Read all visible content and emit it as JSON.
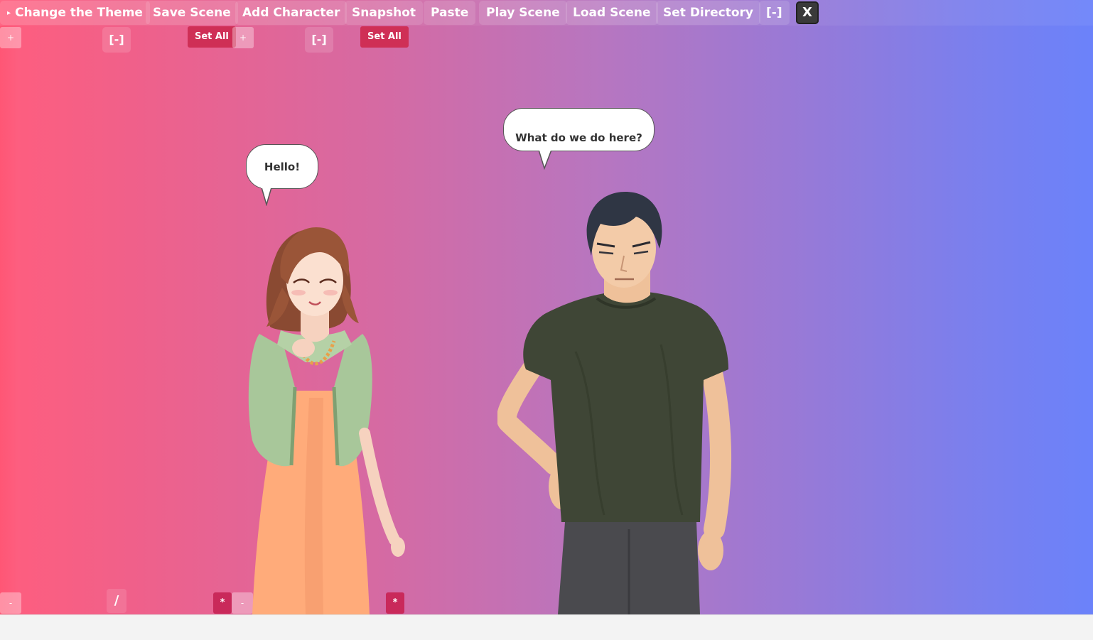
{
  "menu": {
    "theme_label": "Change the Theme",
    "theme_arrow": "▸",
    "save_scene": "Save Scene",
    "add_character": "Add Character",
    "snapshot": "Snapshot",
    "paste": "Paste",
    "play_scene": "Play Scene",
    "load_scene": "Load Scene",
    "set_directory": "Set Directory",
    "collapse": "[-]",
    "close": "X"
  },
  "controls": {
    "plus": "+",
    "minus": "-",
    "collapse": "[-]",
    "set_all": "Set All",
    "slash": "/",
    "star": "*"
  },
  "scene": {
    "bubble_left": "Hello!",
    "bubble_right": "What do we do here?"
  },
  "colors": {
    "gradient_left": "#ff5e7e",
    "gradient_right": "#6b82fa",
    "set_all_bg": "#cf2f56"
  }
}
